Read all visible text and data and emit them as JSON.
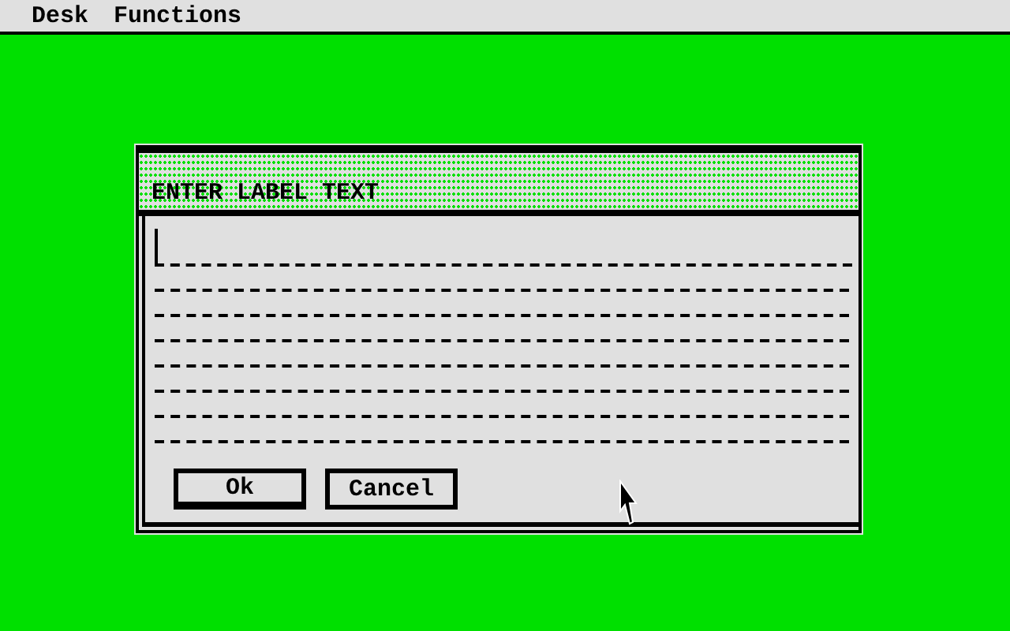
{
  "menu_bar": {
    "items": [
      "Desk",
      "Functions"
    ]
  },
  "dialog": {
    "title": "ENTER LABEL TEXT",
    "lines": [
      {
        "focused": true
      },
      {
        "focused": false
      },
      {
        "focused": false
      },
      {
        "focused": false
      },
      {
        "focused": false
      },
      {
        "focused": false
      },
      {
        "focused": false
      },
      {
        "focused": false
      }
    ],
    "buttons": [
      {
        "label": "Ok",
        "default": true
      },
      {
        "label": "Cancel",
        "default": false
      }
    ]
  }
}
